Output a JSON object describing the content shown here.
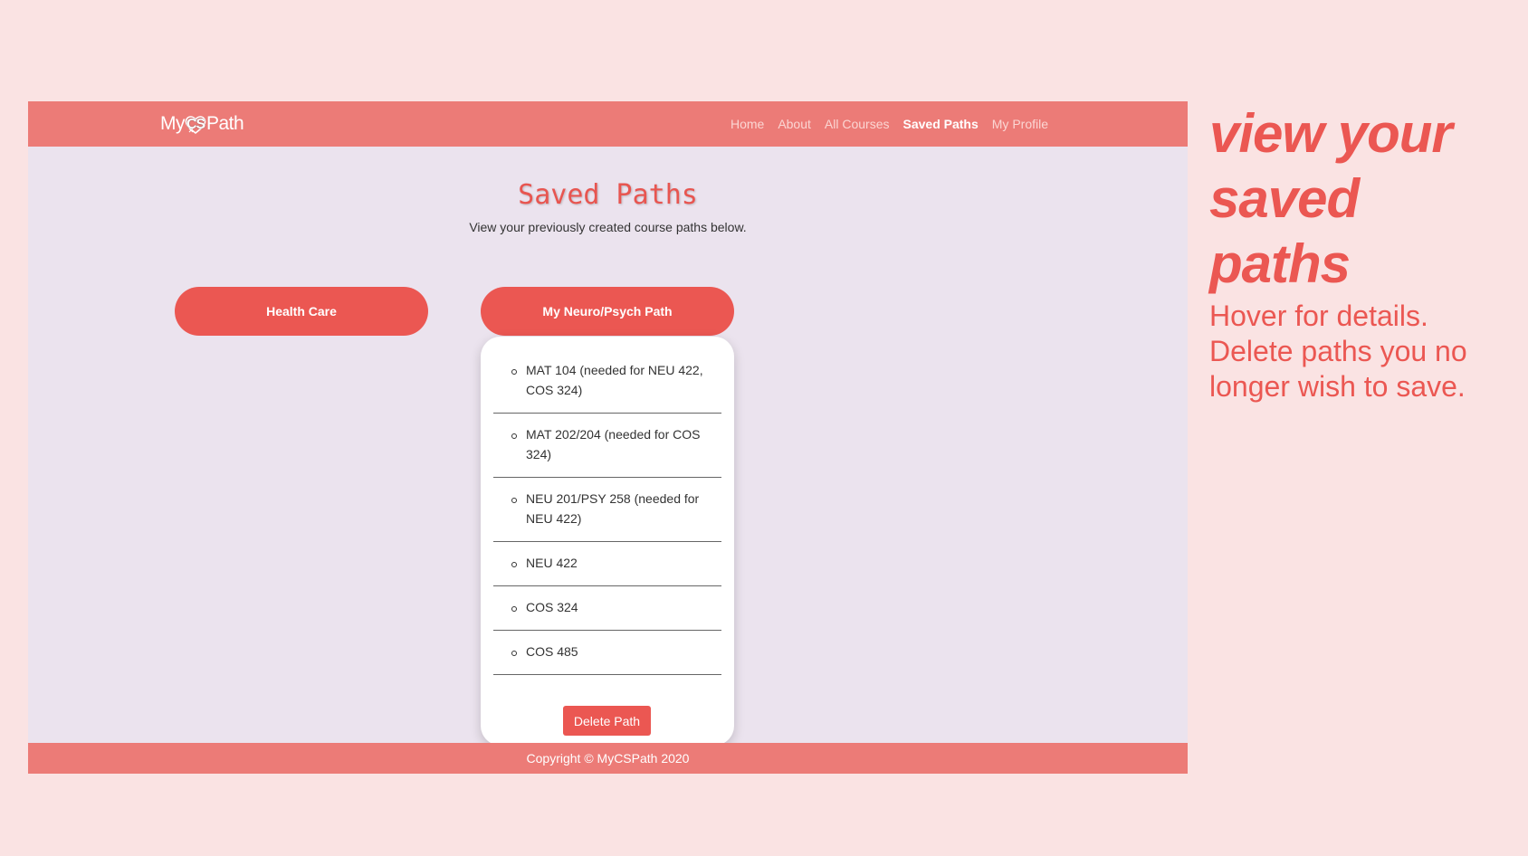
{
  "app": {
    "logo_prefix": "My",
    "logo_mid": "CS",
    "logo_suffix": "Path"
  },
  "nav": {
    "items": [
      "Home",
      "About",
      "All Courses",
      "Saved Paths",
      "My Profile"
    ],
    "active": "Saved Paths"
  },
  "page": {
    "title": "Saved Paths",
    "subtitle": "View your previously created course paths below."
  },
  "paths": [
    {
      "name": "Health Care"
    },
    {
      "name": "My Neuro/Psych Path",
      "courses": [
        "MAT 104 (needed for NEU 422, COS 324)",
        "MAT 202/204 (needed for COS 324)",
        "NEU 201/PSY 258 (needed for NEU 422)",
        "NEU 422",
        "COS 324",
        "COS 485"
      ],
      "delete_label": "Delete Path"
    }
  ],
  "footer": {
    "text": "Copyright © MyCSPath 2020"
  },
  "caption": {
    "heading": "view your saved paths",
    "body": "Hover for details. Delete paths you no longer wish to save."
  },
  "colors": {
    "accent": "#eb5752",
    "navbar": "#ec7b77",
    "background": "#fae3e3",
    "content_bg": "#ebe3ee"
  }
}
